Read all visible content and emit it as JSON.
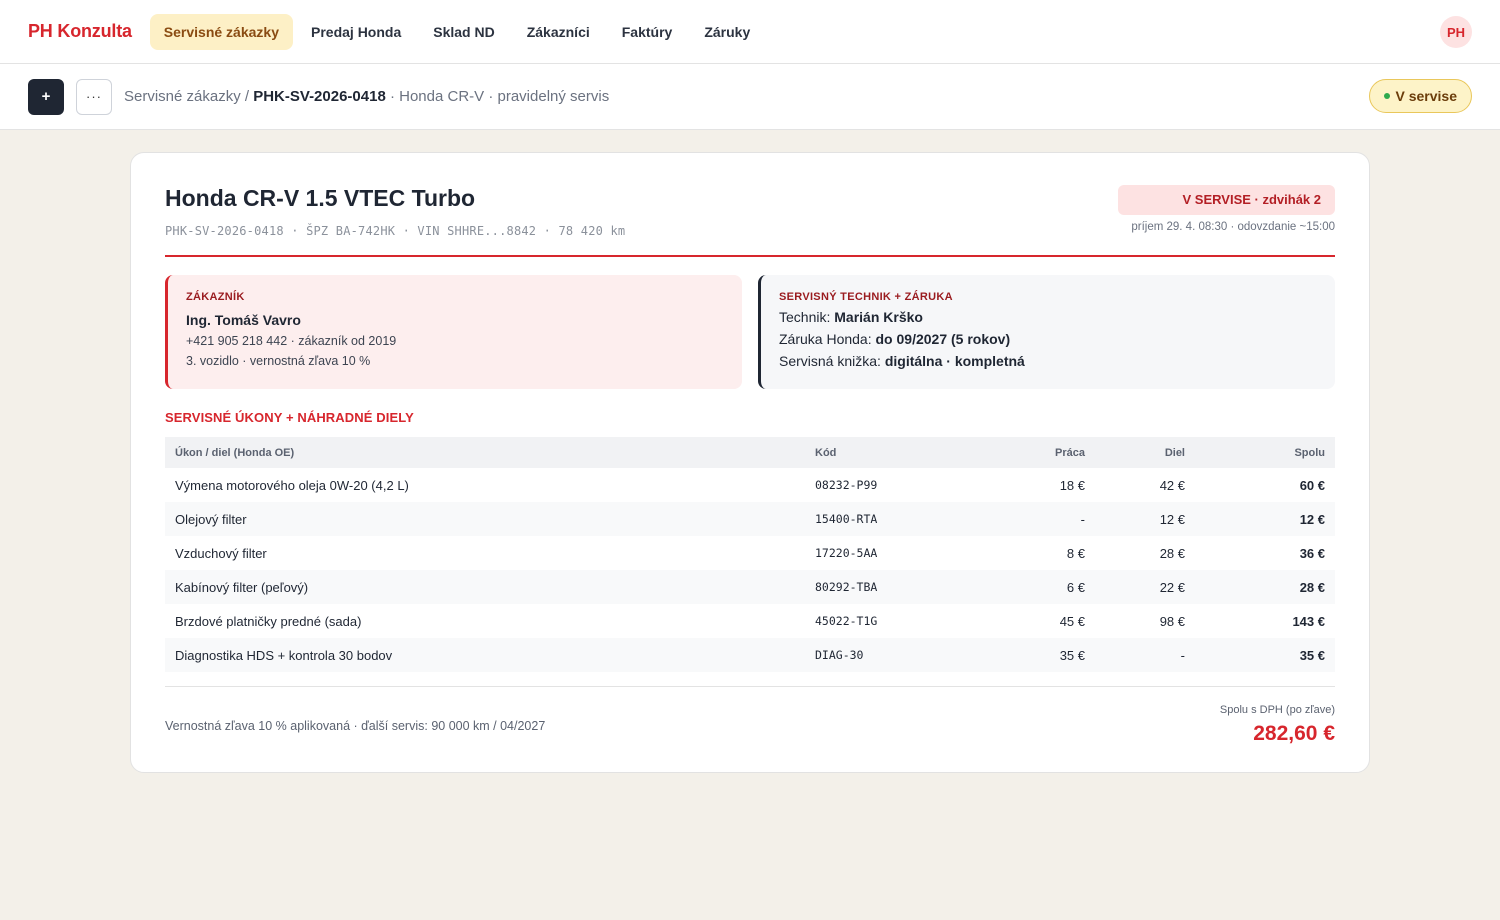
{
  "nav": {
    "brand": "PH Konzulta",
    "items": [
      {
        "label": "Servisné zákazky",
        "active": true
      },
      {
        "label": "Predaj Honda"
      },
      {
        "label": "Sklad ND"
      },
      {
        "label": "Zákazníci"
      },
      {
        "label": "Faktúry"
      },
      {
        "label": "Záruky"
      }
    ],
    "avatar": "PH"
  },
  "toolbar": {
    "plus_label": "+",
    "more_label": "···",
    "breadcrumb_root": "Servisné zákazky / ",
    "breadcrumb_current": "PHK-SV-2026-0418",
    "breadcrumb_suffix": " · Honda CR-V · pravidelný servis",
    "status": "V servise"
  },
  "order": {
    "title": "Honda CR-V 1.5 VTEC Turbo",
    "meta": "PHK-SV-2026-0418 · ŠPZ BA-742HK · VIN SHHRE...8842 · 78 420 km",
    "state_badge": "V SERVISE · zdvihák 2",
    "state_sub": "príjem 29. 4. 08:30 · odovzdanie ~15:00"
  },
  "customer": {
    "label": "ZÁKAZNÍK",
    "name": "Ing. Tomáš Vavro",
    "line1": "+421 905 218 442 · zákazník od 2019",
    "line2": "3. vozidlo · vernostná zľava 10 %"
  },
  "tech": {
    "label": "SERVISNÝ TECHNIK + ZÁRUKA",
    "technician_label": "Technik: ",
    "technician": "Marián Krško",
    "warranty_label": "Záruka Honda: ",
    "warranty": "do 09/2027 (5 rokov)",
    "book_label": "Servisná knižka: ",
    "book": "digitálna · kompletná"
  },
  "items": {
    "section_title": "SERVISNÉ ÚKONY + NÁHRADNÉ DIELY",
    "headers": {
      "name": "Úkon / diel (Honda OE)",
      "code": "Kód",
      "labor": "Práca",
      "part": "Diel",
      "total": "Spolu"
    },
    "rows": [
      {
        "name": "Výmena motorového oleja 0W-20 (4,2 L)",
        "code": "08232-P99",
        "labor": "18 €",
        "part": "42 €",
        "total": "60 €"
      },
      {
        "name": "Olejový filter",
        "code": "15400-RTA",
        "labor": "-",
        "part": "12 €",
        "total": "12 €"
      },
      {
        "name": "Vzduchový filter",
        "code": "17220-5AA",
        "labor": "8 €",
        "part": "28 €",
        "total": "36 €"
      },
      {
        "name": "Kabínový filter (peľový)",
        "code": "80292-TBA",
        "labor": "6 €",
        "part": "22 €",
        "total": "28 €"
      },
      {
        "name": "Brzdové platničky predné (sada)",
        "code": "45022-T1G",
        "labor": "45 €",
        "part": "98 €",
        "total": "143 €"
      },
      {
        "name": "Diagnostika HDS + kontrola 30 bodov",
        "code": "DIAG-30",
        "labor": "35 €",
        "part": "-",
        "total": "35 €"
      }
    ]
  },
  "footer": {
    "note": "Vernostná zľava 10 % aplikovaná · ďalší servis: 90 000 km / 04/2027",
    "total_label": "Spolu s DPH (po zľave)",
    "total": "282,60 €"
  }
}
